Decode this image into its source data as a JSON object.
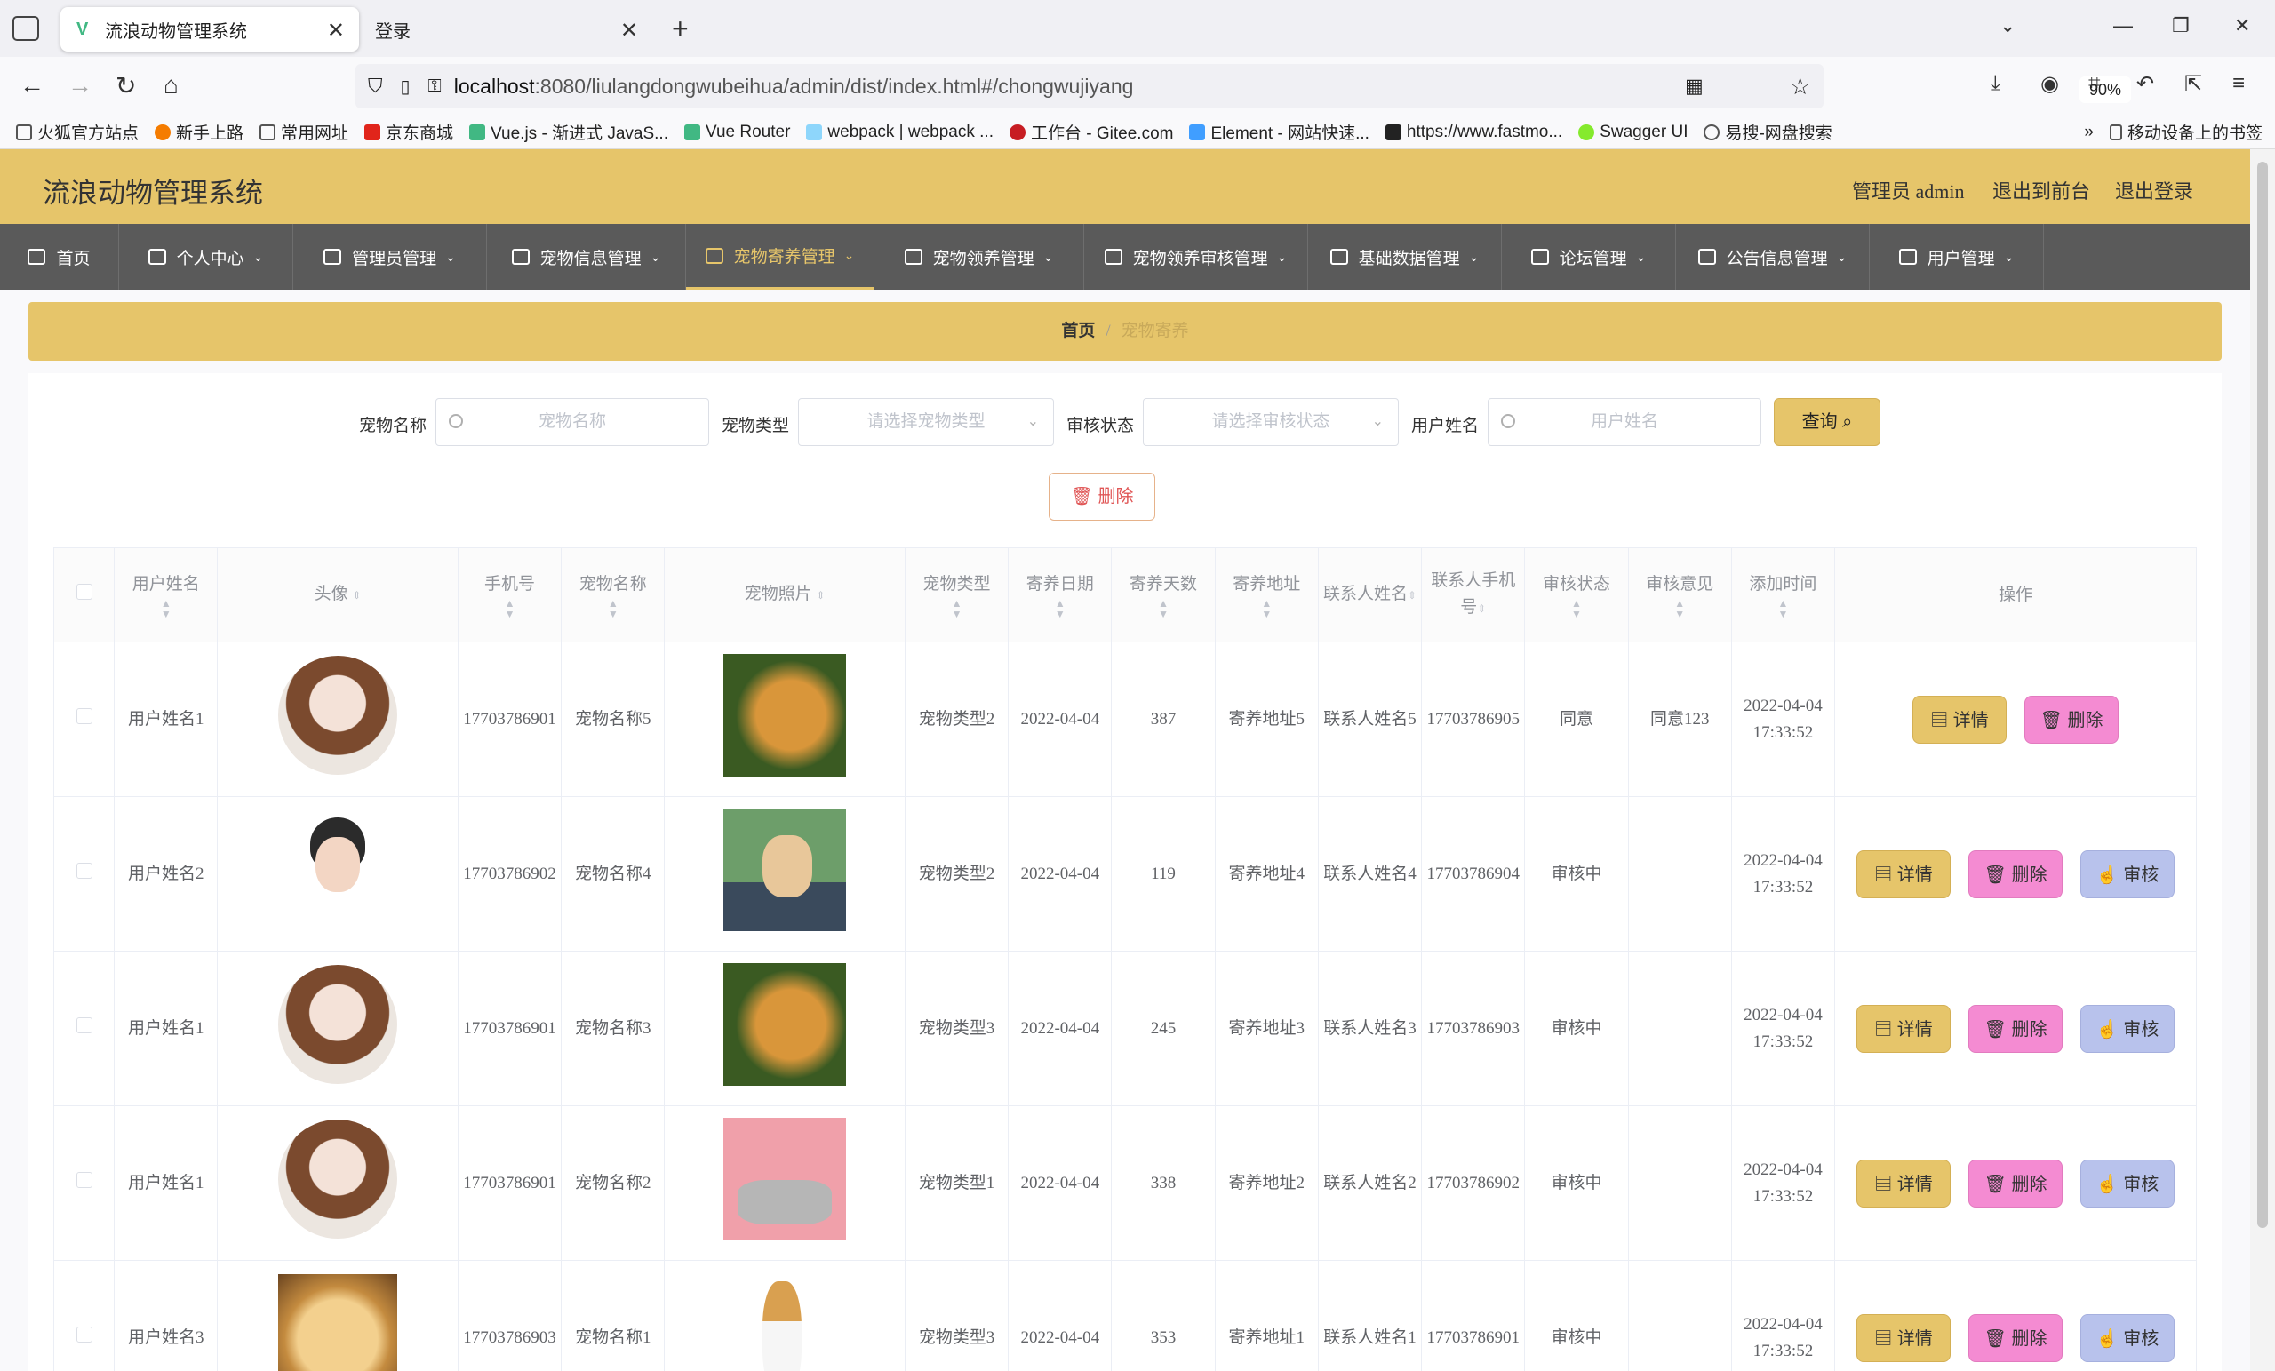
{
  "browser": {
    "tabs": [
      {
        "title": "流浪动物管理系统",
        "active": true
      },
      {
        "title": "登录",
        "active": false
      }
    ],
    "url_host": "localhost",
    "url_path": ":8080/liulangdongwubeihua/admin/dist/index.html#/chongwujiyang",
    "zoom": "90%",
    "bookmarks": [
      "火狐官方站点",
      "新手上路",
      "常用网址",
      "京东商城",
      "Vue.js - 渐进式 JavaS...",
      "Vue Router",
      "webpack | webpack ...",
      "工作台 - Gitee.com",
      "Element - 网站快速...",
      "https://www.fastmo...",
      "Swagger UI",
      "易搜-网盘搜索"
    ],
    "mobile_bookmarks": "移动设备上的书签"
  },
  "header": {
    "title": "流浪动物管理系统",
    "user": "管理员 admin",
    "to_front": "退出到前台",
    "logout": "退出登录"
  },
  "menu": [
    {
      "label": "首页",
      "icon": "home-icon",
      "caret": false,
      "active": false
    },
    {
      "label": "个人中心",
      "icon": "user-icon",
      "caret": true,
      "active": false
    },
    {
      "label": "管理员管理",
      "icon": "sliders-icon",
      "caret": true,
      "active": false
    },
    {
      "label": "宠物信息管理",
      "icon": "list-icon",
      "caret": true,
      "active": false
    },
    {
      "label": "宠物寄养管理",
      "icon": "ticket-icon",
      "caret": true,
      "active": true
    },
    {
      "label": "宠物领养管理",
      "icon": "clipboard-icon",
      "caret": true,
      "active": false
    },
    {
      "label": "宠物领养审核管理",
      "icon": "book-icon",
      "caret": true,
      "active": false
    },
    {
      "label": "基础数据管理",
      "icon": "monitor-icon",
      "caret": true,
      "active": false
    },
    {
      "label": "论坛管理",
      "icon": "laptop-icon",
      "caret": true,
      "active": false
    },
    {
      "label": "公告信息管理",
      "icon": "briefcase-icon",
      "caret": true,
      "active": false
    },
    {
      "label": "用户管理",
      "icon": "menu-icon",
      "caret": true,
      "active": false
    }
  ],
  "breadcrumb": {
    "home": "首页",
    "sep": "/",
    "current": "宠物寄养"
  },
  "search": {
    "pet_name_label": "宠物名称",
    "pet_name_placeholder": "宠物名称",
    "pet_type_label": "宠物类型",
    "pet_type_placeholder": "请选择宠物类型",
    "status_label": "审核状态",
    "status_placeholder": "请选择审核状态",
    "user_label": "用户姓名",
    "user_placeholder": "用户姓名",
    "query": "查询"
  },
  "delete_button": "删除",
  "table": {
    "headers": {
      "user": "用户姓名",
      "avatar": "头像",
      "phone": "手机号",
      "pet_name": "宠物名称",
      "photo": "宠物照片",
      "pet_type": "宠物类型",
      "date": "寄养日期",
      "days": "寄养天数",
      "address": "寄养地址",
      "contact": "联系人姓名",
      "contact_phone": "联系人手机号",
      "status": "审核状态",
      "opinion": "审核意见",
      "created": "添加时间",
      "ops": "操作"
    },
    "rows": [
      {
        "user": "用户姓名1",
        "avatar": "girl",
        "phone": "17703786901",
        "pet_name": "宠物名称5",
        "photo": "golden",
        "pet_type": "宠物类型2",
        "date": "2022-04-04",
        "days": "387",
        "address": "寄养地址5",
        "contact": "联系人姓名5",
        "contact_phone": "17703786905",
        "status": "同意",
        "opinion": "同意123",
        "created": "2022-04-04 17:33:52",
        "review": false
      },
      {
        "user": "用户姓名2",
        "avatar": "male",
        "phone": "17703786902",
        "pet_name": "宠物名称4",
        "photo": "corgi",
        "pet_type": "宠物类型2",
        "date": "2022-04-04",
        "days": "119",
        "address": "寄养地址4",
        "contact": "联系人姓名4",
        "contact_phone": "17703786904",
        "status": "审核中",
        "opinion": "",
        "created": "2022-04-04 17:33:52",
        "review": true
      },
      {
        "user": "用户姓名1",
        "avatar": "girl",
        "phone": "17703786901",
        "pet_name": "宠物名称3",
        "photo": "golden",
        "pet_type": "宠物类型3",
        "date": "2022-04-04",
        "days": "245",
        "address": "寄养地址3",
        "contact": "联系人姓名3",
        "contact_phone": "17703786903",
        "status": "审核中",
        "opinion": "",
        "created": "2022-04-04 17:33:52",
        "review": true
      },
      {
        "user": "用户姓名1",
        "avatar": "girl",
        "phone": "17703786901",
        "pet_name": "宠物名称2",
        "photo": "pink",
        "pet_type": "宠物类型1",
        "date": "2022-04-04",
        "days": "338",
        "address": "寄养地址2",
        "contact": "联系人姓名2",
        "contact_phone": "17703786902",
        "status": "审核中",
        "opinion": "",
        "created": "2022-04-04 17:33:52",
        "review": true
      },
      {
        "user": "用户姓名3",
        "avatar": "puppy",
        "phone": "17703786903",
        "pet_name": "宠物名称1",
        "photo": "white",
        "pet_type": "宠物类型3",
        "date": "2022-04-04",
        "days": "353",
        "address": "寄养地址1",
        "contact": "联系人姓名1",
        "contact_phone": "17703786901",
        "status": "审核中",
        "opinion": "",
        "created": "2022-04-04 17:33:52",
        "review": true
      }
    ],
    "op_labels": {
      "detail": "详情",
      "delete": "删除",
      "review": "审核"
    }
  },
  "colors": {
    "accent": "#e6c56a",
    "menu_bg": "#5a5a5a",
    "delete_btn": "#f48bd2",
    "review_btn": "#b8c2ec"
  }
}
